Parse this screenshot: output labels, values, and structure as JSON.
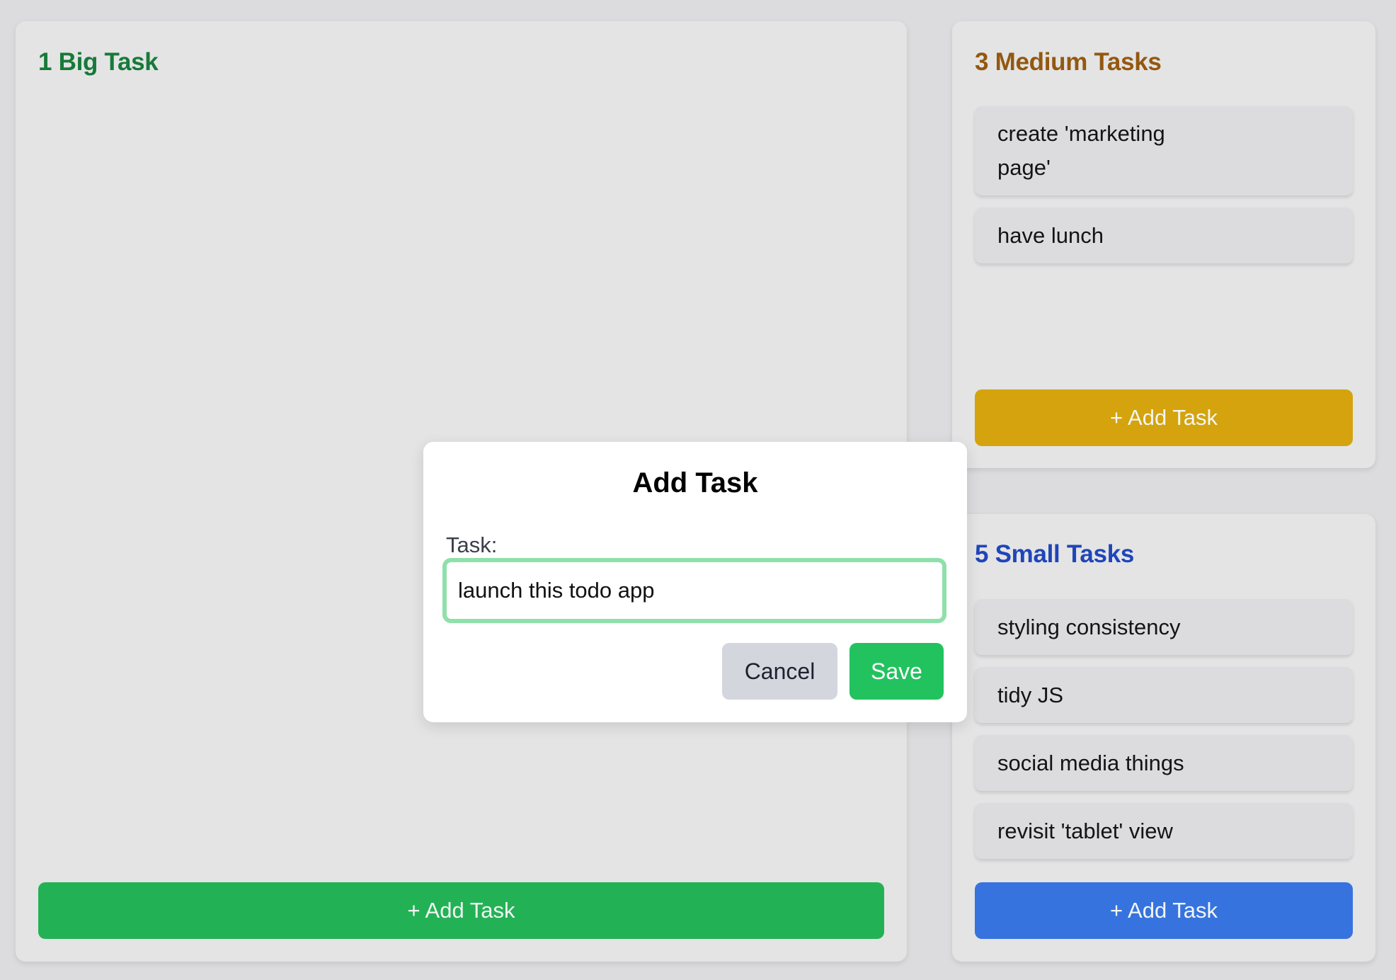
{
  "panels": {
    "big": {
      "title": "1 Big Task",
      "tasks": [],
      "add_label": "+ Add Task"
    },
    "medium": {
      "title": "3 Medium Tasks",
      "tasks": [
        "create 'marketing page'",
        "have lunch"
      ],
      "add_label": "+ Add Task"
    },
    "small": {
      "title": "5 Small Tasks",
      "tasks": [
        "styling consistency",
        "tidy JS",
        "social media things",
        "revisit 'tablet' view"
      ],
      "add_label": "+ Add Task"
    }
  },
  "modal": {
    "title": "Add Task",
    "label": "Task:",
    "input_value": "launch this todo app",
    "cancel_label": "Cancel",
    "save_label": "Save"
  },
  "colors": {
    "big_accent": "#22b255",
    "medium_accent": "#d4a30d",
    "small_accent": "#3673df",
    "save": "#22c25e"
  }
}
